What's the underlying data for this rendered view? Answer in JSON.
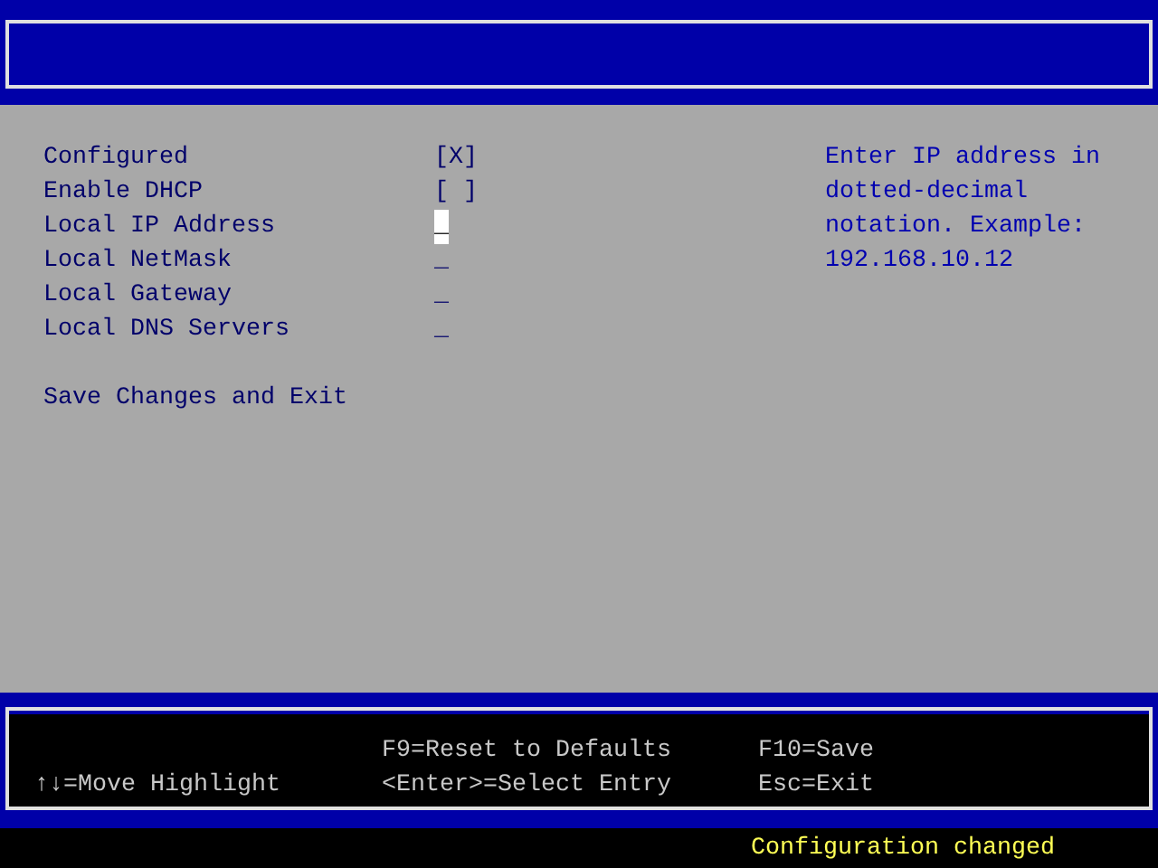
{
  "items": [
    {
      "label": "Configured",
      "value": "[X]",
      "selected": false
    },
    {
      "label": "Enable DHCP",
      "value": "[ ]",
      "selected": false
    },
    {
      "label": "Local IP Address",
      "value": "_",
      "selected": true
    },
    {
      "label": "Local NetMask",
      "value": "_",
      "selected": false
    },
    {
      "label": "Local Gateway",
      "value": "_",
      "selected": false
    },
    {
      "label": "Local DNS Servers",
      "value": "_",
      "selected": false
    }
  ],
  "action": "Save Changes and Exit",
  "help_text": [
    "Enter IP address in",
    "dotted-decimal",
    "notation. Example:",
    "192.168.10.12"
  ],
  "key_hints": [
    {
      "lines": [
        "↑↓=Move Highlight"
      ]
    },
    {
      "lines": [
        "F9=Reset to Defaults",
        "<Enter>=Select Entry"
      ]
    },
    {
      "lines": [
        "F10=Save",
        "Esc=Exit"
      ]
    }
  ],
  "status": "Configuration changed"
}
